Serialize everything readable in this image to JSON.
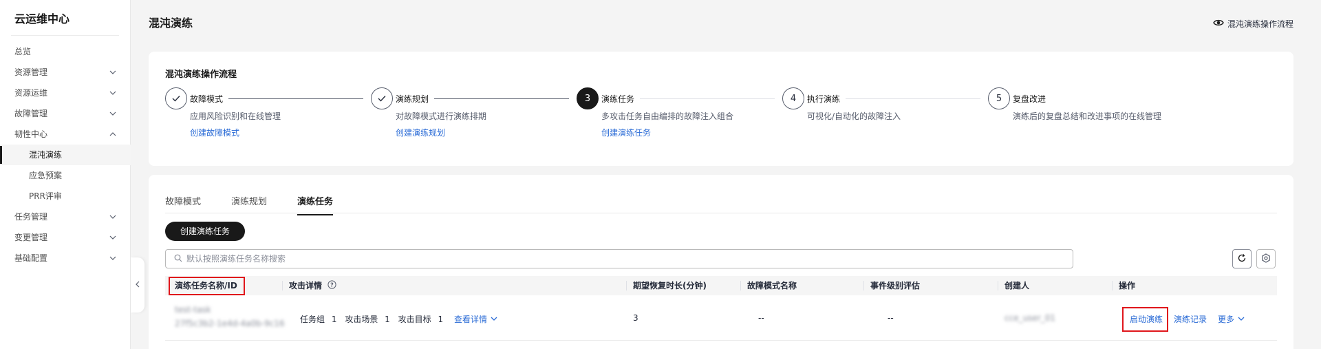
{
  "sidebar": {
    "title": "云运维中心",
    "items": [
      {
        "label": "总览",
        "expand": ""
      },
      {
        "label": "资源管理",
        "expand": "down"
      },
      {
        "label": "资源运维",
        "expand": "down"
      },
      {
        "label": "故障管理",
        "expand": "down"
      },
      {
        "label": "韧性中心",
        "expand": "up"
      },
      {
        "label": "混沌演练",
        "sub": true,
        "active": true
      },
      {
        "label": "应急预案",
        "sub": true
      },
      {
        "label": "PRR评审",
        "sub": true
      },
      {
        "label": "任务管理",
        "expand": "down"
      },
      {
        "label": "变更管理",
        "expand": "down"
      },
      {
        "label": "基础配置",
        "expand": "down"
      }
    ]
  },
  "header": {
    "title": "混沌演练",
    "view_flow_label": "混沌演练操作流程"
  },
  "flow": {
    "title": "混沌演练操作流程",
    "steps": [
      {
        "marker": "✓",
        "status": "done",
        "title": "故障模式",
        "desc": "应用风险识别和在线管理",
        "link": "创建故障模式"
      },
      {
        "marker": "✓",
        "status": "done",
        "title": "演练规划",
        "desc": "对故障模式进行演练排期",
        "link": "创建演练规划"
      },
      {
        "marker": "3",
        "status": "current",
        "title": "演练任务",
        "desc": "多攻击任务自由编排的故障注入组合",
        "link": "创建演练任务"
      },
      {
        "marker": "4",
        "status": "todo",
        "title": "执行演练",
        "desc": "可视化/自动化的故障注入",
        "link": ""
      },
      {
        "marker": "5",
        "status": "todo",
        "title": "复盘改进",
        "desc": "演练后的复盘总结和改进事项的在线管理",
        "link": ""
      }
    ]
  },
  "tabs": [
    {
      "label": "故障模式",
      "active": false
    },
    {
      "label": "演练规划",
      "active": false
    },
    {
      "label": "演练任务",
      "active": true
    }
  ],
  "toolbar": {
    "create_label": "创建演练任务",
    "search_placeholder": "默认按照演练任务名称搜索"
  },
  "table": {
    "columns": [
      "演练任务名称/ID",
      "攻击详情",
      "期望恢复时长(分钟)",
      "故障模式名称",
      "事件级别评估",
      "创建人",
      "操作"
    ],
    "rows": [
      {
        "name": "test-task",
        "id": "27f5c3b2-1e4d-4a0b-9c16",
        "attack_groups_label": "任务组",
        "attack_groups": "1",
        "attack_scenes_label": "攻击场景",
        "attack_scenes": "1",
        "attack_targets_label": "攻击目标",
        "attack_targets": "1",
        "attack_detail_link": "查看详情",
        "recovery_minutes": "3",
        "fault_mode": "--",
        "event_level": "--",
        "creator": "cce_user_01",
        "actions": {
          "start": "启动演练",
          "record": "演练记录",
          "more": "更多"
        }
      }
    ]
  },
  "colors": {
    "accent": "#191919",
    "link": "#2a6bd6",
    "highlight": "#e0161b"
  }
}
